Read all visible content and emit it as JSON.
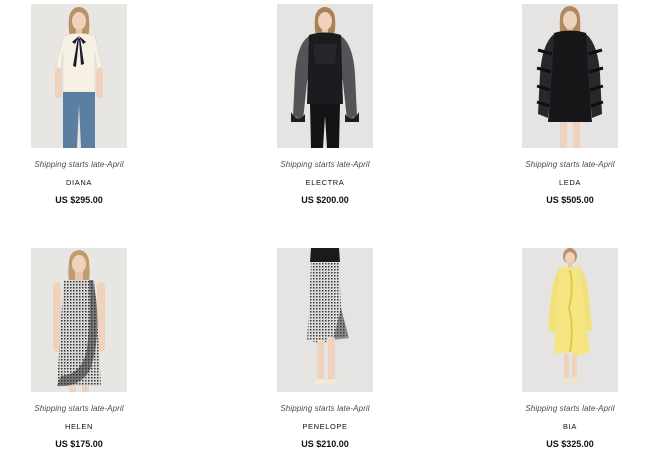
{
  "products": [
    {
      "shipping": "Shipping starts late-April",
      "name": "DIANA",
      "price": "US $295.00",
      "image": "model-cream-blouse-bow-jeans"
    },
    {
      "shipping": "Shipping starts late-April",
      "name": "ELECTRA",
      "price": "US $200.00",
      "image": "model-black-sheer-top-pants"
    },
    {
      "shipping": "Shipping starts late-April",
      "name": "LEDA",
      "price": "US $505.00",
      "image": "model-black-lace-ruffle-dress"
    },
    {
      "shipping": "Shipping starts late-April",
      "name": "HELEN",
      "price": "US $175.00",
      "image": "model-gingham-ruffle-dress"
    },
    {
      "shipping": "Shipping starts late-April",
      "name": "PENELOPE",
      "price": "US $210.00",
      "image": "model-gingham-ruffle-skirt"
    },
    {
      "shipping": "Shipping starts late-April",
      "name": "BIA",
      "price": "US $325.00",
      "image": "model-yellow-ruffle-dress"
    }
  ]
}
